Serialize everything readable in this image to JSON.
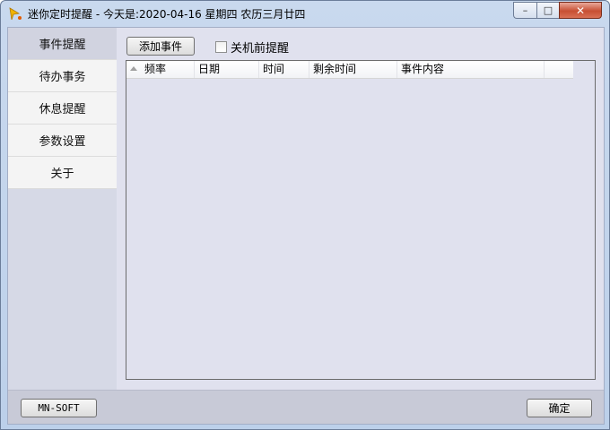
{
  "window": {
    "title": "迷你定时提醒 - 今天是:2020-04-16 星期四 农历三月廿四",
    "icons": {
      "app": "bell-icon",
      "minimize": "minimize-icon",
      "maximize": "maximize-icon",
      "close": "close-icon"
    },
    "controls": {
      "minimize": "–",
      "maximize": "□",
      "close": "✕"
    }
  },
  "sidebar": {
    "items": [
      {
        "label": "事件提醒",
        "active": true
      },
      {
        "label": "待办事务",
        "active": false
      },
      {
        "label": "休息提醒",
        "active": false
      },
      {
        "label": "参数设置",
        "active": false
      },
      {
        "label": "关于",
        "active": false
      }
    ]
  },
  "toolbar": {
    "add_label": "添加事件",
    "shutdown_remind_label": "关机前提醒",
    "shutdown_remind_checked": false
  },
  "event_list": {
    "columns": [
      "频率",
      "日期",
      "时间",
      "剩余时间",
      "事件内容"
    ],
    "rows": []
  },
  "footer": {
    "brand_label": "MN-SOFT",
    "ok_label": "确定"
  }
}
